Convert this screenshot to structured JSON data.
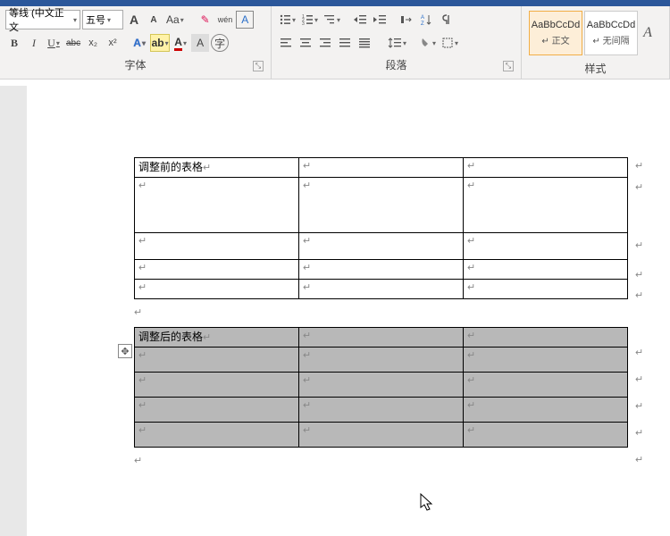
{
  "font": {
    "family": "等线 (中文正文",
    "size": "五号",
    "grow": "A",
    "shrink": "A",
    "case": "Aa",
    "phonetic": "wén",
    "charborder": "A",
    "bold": "B",
    "italic": "I",
    "underline": "U",
    "strike": "abc",
    "sub": "x₂",
    "sup": "x²",
    "texteffects": "A",
    "highlight": "A",
    "fontcolor": "A",
    "charshade": "A",
    "clearfmt": "✕",
    "group_label": "字体"
  },
  "para": {
    "group_label": "段落"
  },
  "styles": {
    "preview": "AaBbCcDd",
    "s1": "↵ 正文",
    "s2": "↵ 无间隔",
    "group_label": "样式"
  },
  "table1": {
    "caption": "调整前的表格"
  },
  "table2": {
    "caption": "调整后的表格"
  }
}
